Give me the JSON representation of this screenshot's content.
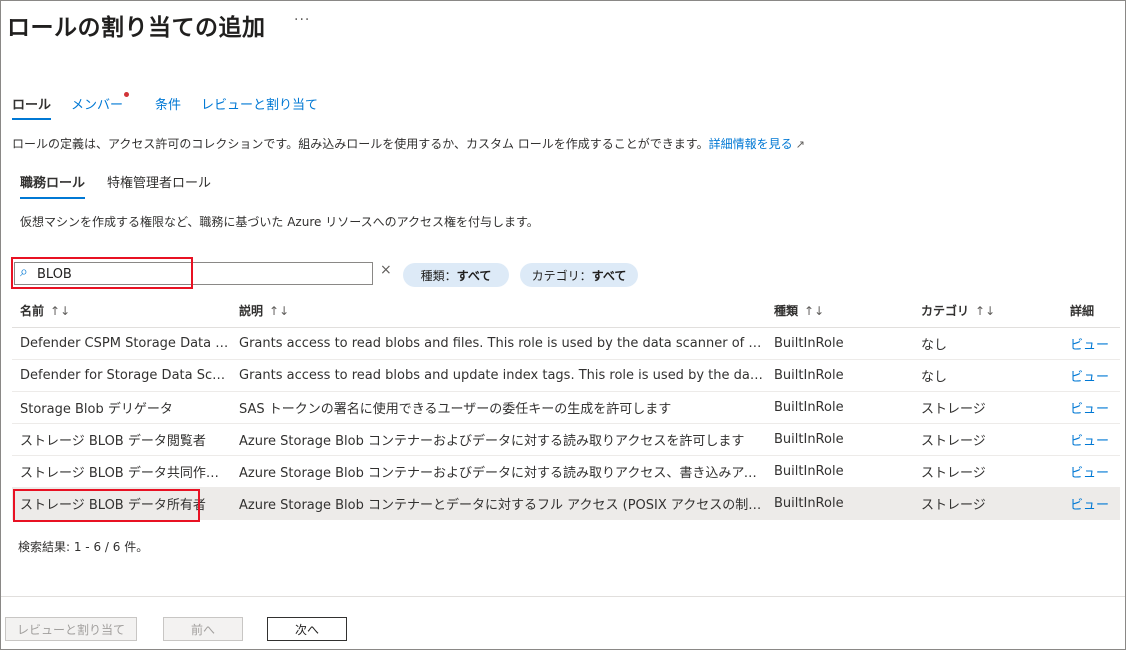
{
  "page": {
    "title": "ロールの割り当ての追加",
    "more": "···"
  },
  "tabs": [
    {
      "label": "ロール",
      "active": true
    },
    {
      "label": "メンバー",
      "has_dot": true
    },
    {
      "label": "条件"
    },
    {
      "label": "レビューと割り当て"
    }
  ],
  "description": {
    "text": "ロールの定義は、アクセス許可のコレクションです。組み込みロールを使用するか、カスタム ロールを作成することができます。",
    "link": "詳細情報を見る",
    "link_icon": "external-link-icon"
  },
  "subtabs": [
    {
      "label": "職務ロール",
      "active": true
    },
    {
      "label": "特権管理者ロール"
    }
  ],
  "subdescription": "仮想マシンを作成する権限など、職務に基づいた Azure リソースへのアクセス権を付与します。",
  "search": {
    "value": "BLOB",
    "icon": "search-icon",
    "clear": "×"
  },
  "filters": {
    "type": {
      "label": "種類：",
      "value": "すべて"
    },
    "category": {
      "label": "カテゴリ：",
      "value": "すべて"
    }
  },
  "table": {
    "columns": [
      {
        "label": "名前",
        "sort": "↑↓"
      },
      {
        "label": "説明",
        "sort": "↑↓"
      },
      {
        "label": "種類",
        "sort": "↑↓"
      },
      {
        "label": "カテゴリ",
        "sort": "↑↓"
      },
      {
        "label": "詳細"
      }
    ],
    "rows": [
      {
        "name": "Defender CSPM Storage Data …",
        "description": "Grants access to read blobs and files. This role is used by the data scanner of Df…",
        "type": "BuiltInRole",
        "category": "なし",
        "detail": "ビュー"
      },
      {
        "name": "Defender for Storage Data Sca…",
        "description": "Grants access to read blobs and update index tags. This role is used by the data …",
        "type": "BuiltInRole",
        "category": "なし",
        "detail": "ビュー"
      },
      {
        "name": "Storage Blob デリゲータ",
        "description": "SAS トークンの署名に使用できるユーザーの委任キーの生成を許可します",
        "type": "BuiltInRole",
        "category": "ストレージ",
        "detail": "ビュー"
      },
      {
        "name": "ストレージ BLOB データ閲覧者",
        "description": "Azure Storage Blob コンテナーおよびデータに対する読み取りアクセスを許可します",
        "type": "BuiltInRole",
        "category": "ストレージ",
        "detail": "ビュー"
      },
      {
        "name": "ストレージ BLOB データ共同作成者",
        "description": "Azure Storage Blob コンテナーおよびデータに対する読み取りアクセス、書き込みアクセス、削除ア…",
        "type": "BuiltInRole",
        "category": "ストレージ",
        "detail": "ビュー"
      },
      {
        "name": "ストレージ BLOB データ所有者",
        "description": "Azure Storage Blob コンテナーとデータに対するフル アクセス (POSIX アクセスの制御の割り当て…",
        "type": "BuiltInRole",
        "category": "ストレージ",
        "detail": "ビュー",
        "selected": true
      }
    ]
  },
  "results": "検索結果: 1 - 6 / 6 件。",
  "footer": {
    "review_button": "レビューと割り当て",
    "prev_button": "前へ",
    "next_button": "次へ"
  },
  "colors": {
    "accent": "#0078d4",
    "highlight_outline": "#e81123",
    "notification_dot": "#d13438",
    "pill_bg": "#ddeaf7"
  }
}
